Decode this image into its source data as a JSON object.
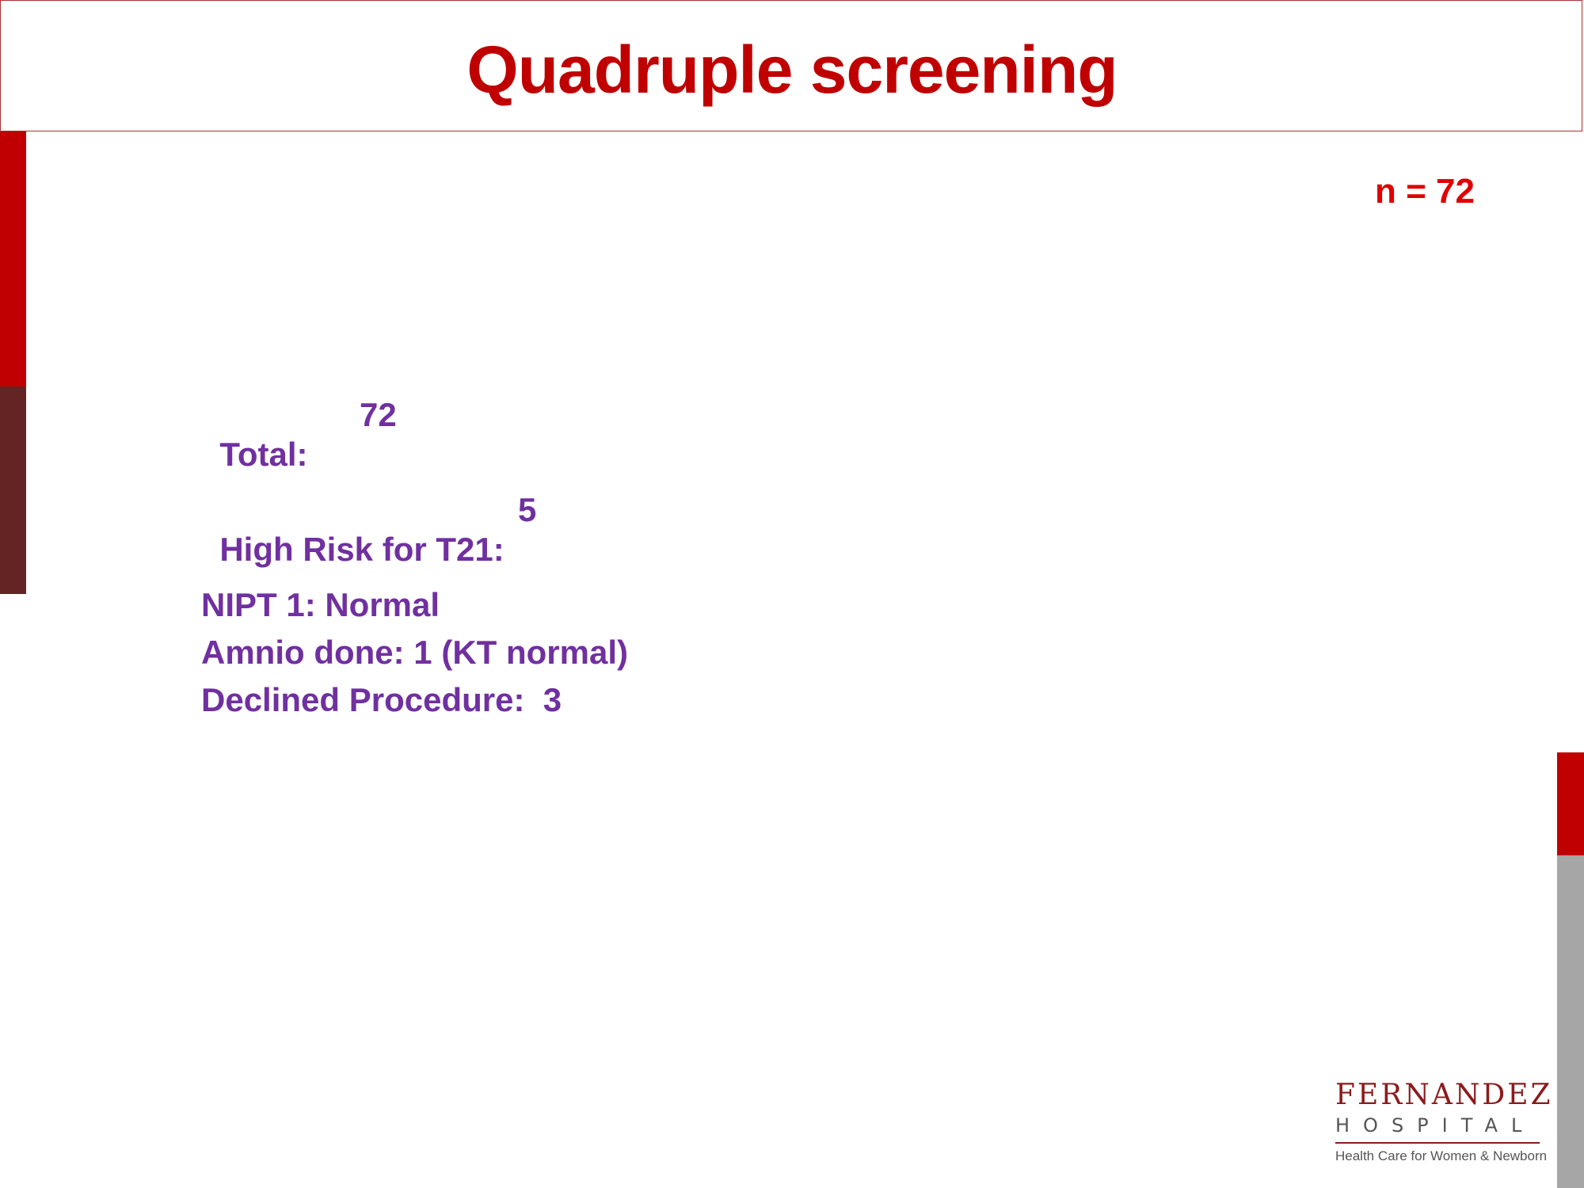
{
  "slide": {
    "title": "Quadruple screening",
    "n_label": "n = 72",
    "stats": {
      "total_label": "Total:",
      "total_value": "72",
      "high_risk_label": "High Risk for T21:",
      "high_risk_value": "5",
      "nipt_line": "NIPT 1: Normal",
      "amnio_line": "Amnio done: 1 (KT normal)",
      "declined_line": "Declined Procedure:  3"
    }
  },
  "logo": {
    "name": "FERNANDEZ",
    "hospital": "HOSPITAL",
    "tagline": "Health Care for Women & Newborn"
  },
  "colors": {
    "title_red": "#c00000",
    "n_label_red": "#e00000",
    "body_purple": "#7030a0",
    "accent_dark_red": "#632523",
    "accent_gray": "#a6a6a6"
  }
}
